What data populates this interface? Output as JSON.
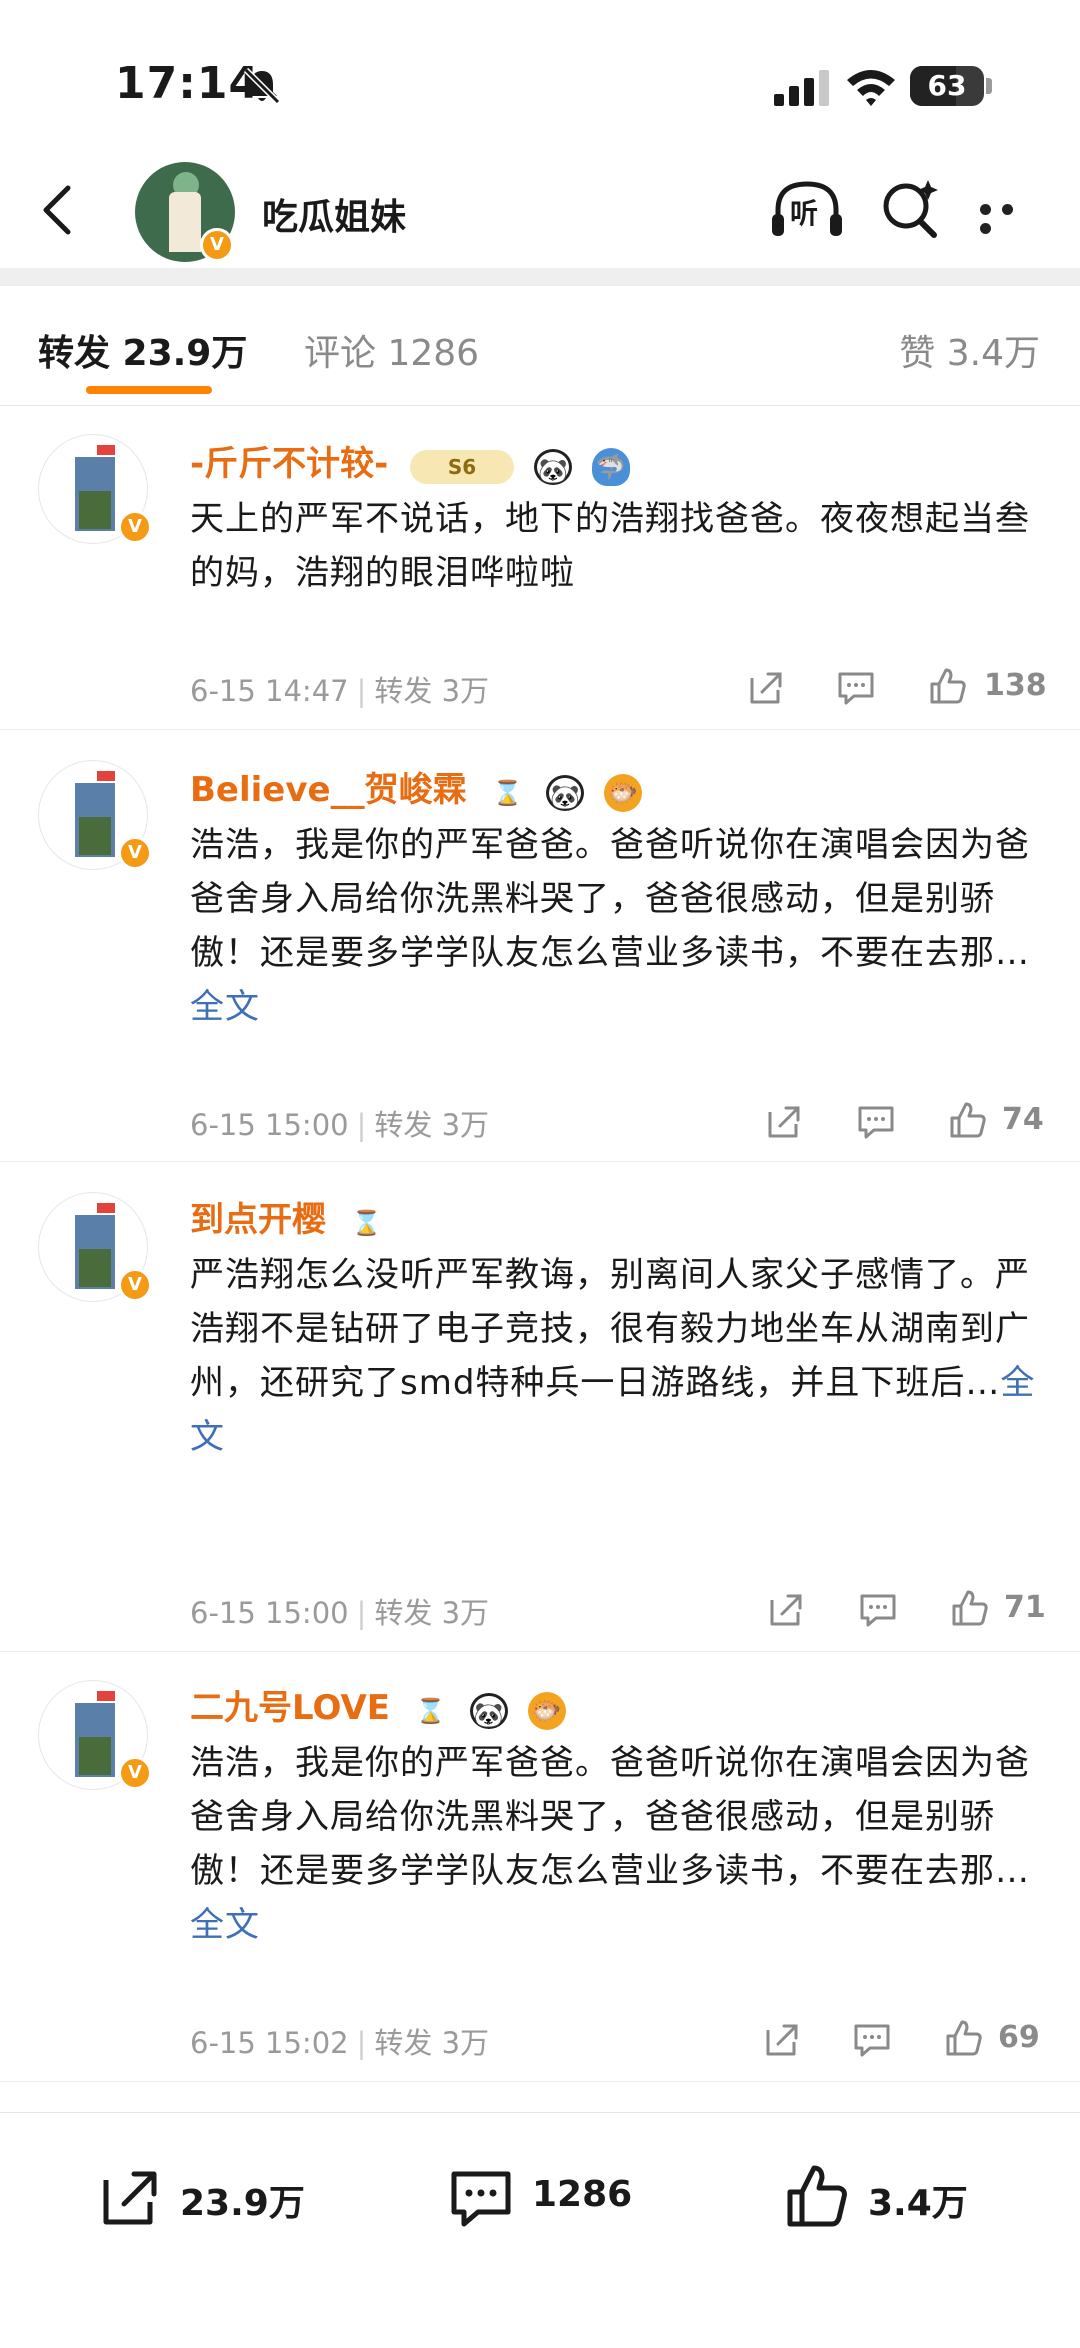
{
  "status_bar": {
    "time": "17:14",
    "battery": "63"
  },
  "nav": {
    "title": "吃瓜姐妹",
    "listen_label": "听"
  },
  "tabs": {
    "repost": "转发 23.9万",
    "comment": "评论 1286",
    "like": "赞 3.4万"
  },
  "posts": [
    {
      "name": "-斤斤不计较-",
      "badge_text": "S6",
      "text": "天上的严军不说话，地下的浩翔找爸爸。夜夜想起当叁的妈，浩翔的眼泪哗啦啦",
      "more": "",
      "time": "6-15 14:47",
      "repost": "转发 3万",
      "likes": "138"
    },
    {
      "name": "Believe__贺峻霖",
      "text": "浩浩，我是你的严军爸爸。爸爸听说你在演唱会因为爸爸舍身入局给你洗黑料哭了，爸爸很感动，但是别骄傲！还是要多学学队友怎么营业多读书，不要在去那…",
      "more": "全文",
      "time": "6-15 15:00",
      "repost": "转发 3万",
      "likes": "74"
    },
    {
      "name": "到点开樱",
      "text": "严浩翔怎么没听严军教诲，别离间人家父子感情了。严浩翔不是钻研了电子竞技，很有毅力地坐车从湖南到广州，还研究了smd特种兵一日游路线，并且下班后…",
      "more": "全文",
      "time": "6-15 15:00",
      "repost": "转发 3万",
      "likes": "71"
    },
    {
      "name": "二九号LOVE",
      "text": "浩浩，我是你的严军爸爸。爸爸听说你在演唱会因为爸爸舍身入局给你洗黑料哭了，爸爸很感动，但是别骄傲！还是要多学学队友怎么营业多读书，不要在去那…",
      "more": "全文",
      "time": "6-15 15:02",
      "repost": "转发 3万",
      "likes": "69"
    }
  ],
  "bottom_bar": {
    "repost": "23.9万",
    "comment": "1286",
    "like": "3.4万"
  },
  "colors": {
    "accent": "#ff8200",
    "username": "#e86c12",
    "link": "#3f6fb5",
    "verify": "#f59a14"
  },
  "icons": [
    "back-arrow-icon",
    "bell-off-icon",
    "signal-icon",
    "wifi-icon",
    "battery-icon",
    "headphones-listen-icon",
    "search-icon",
    "more-icon",
    "share-icon",
    "comment-icon",
    "like-icon",
    "verified-badge-icon"
  ]
}
